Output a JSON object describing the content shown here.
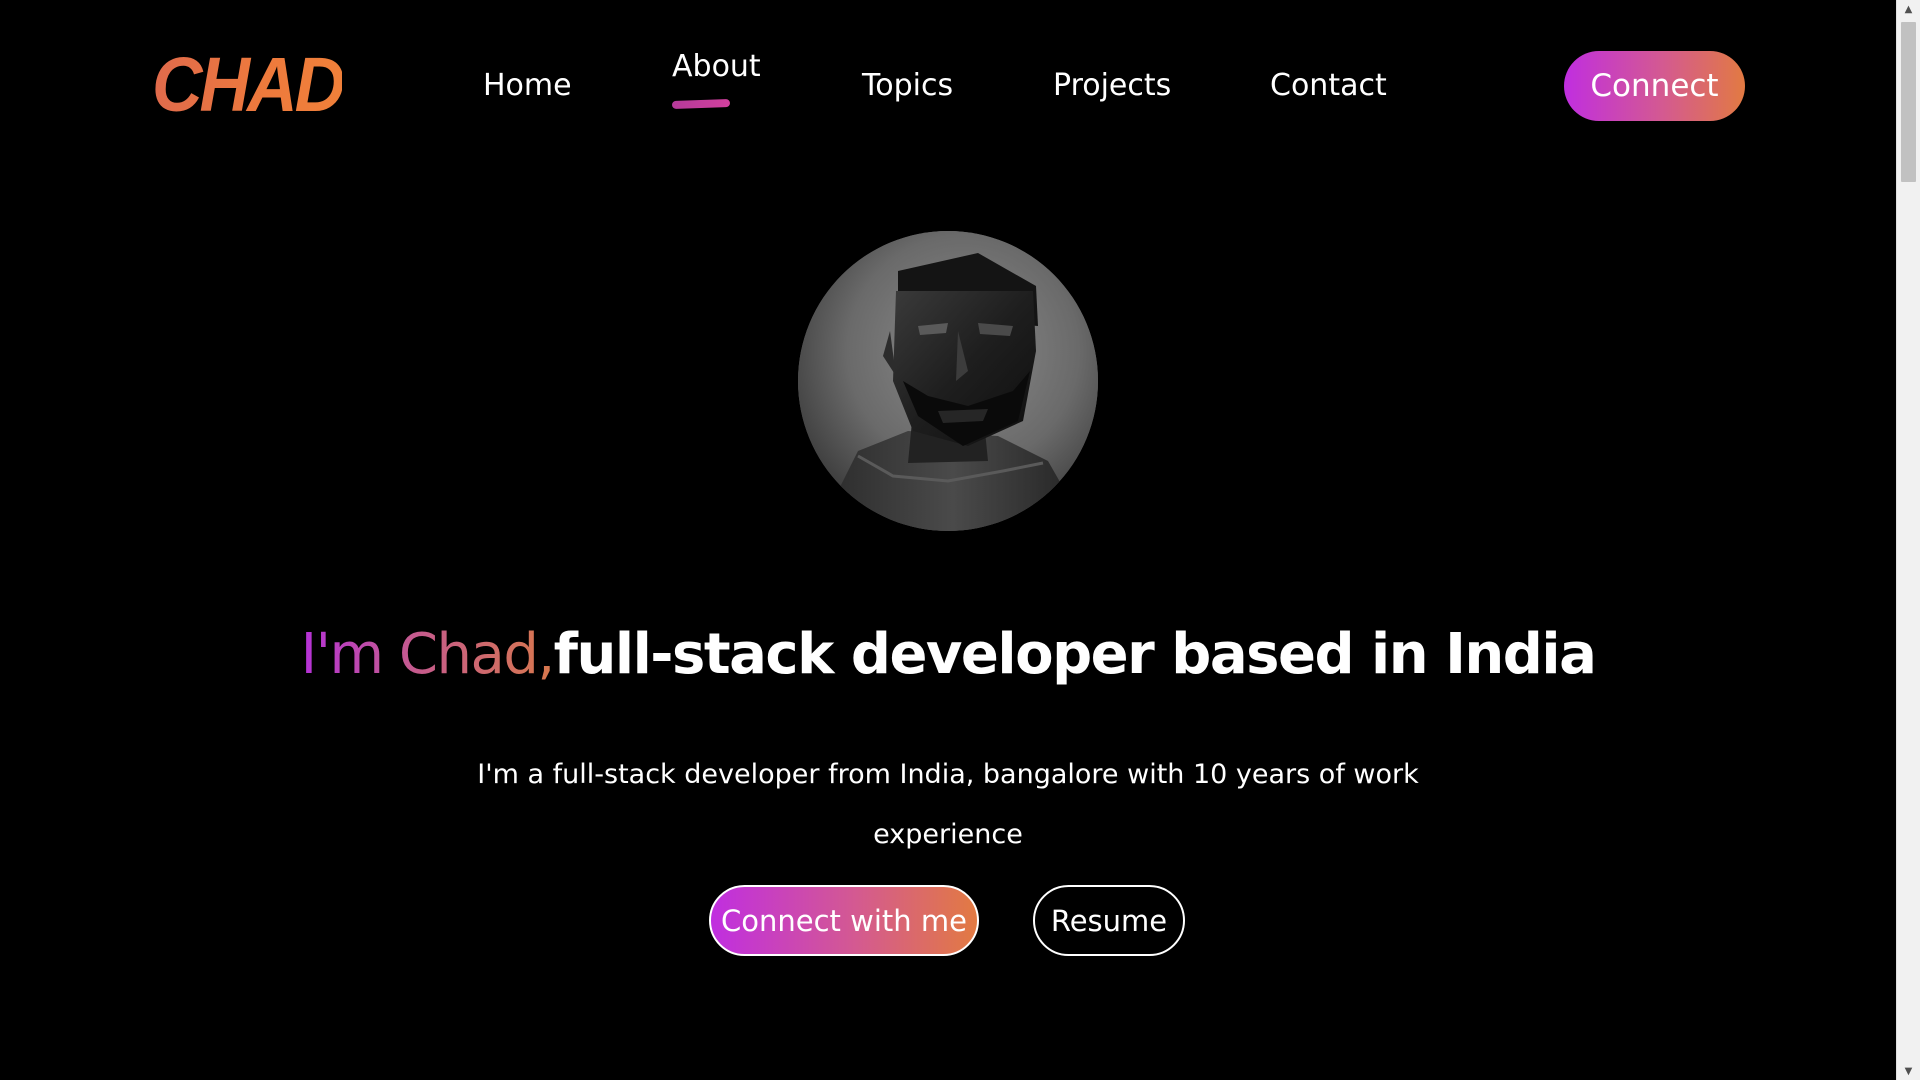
{
  "nav": {
    "logo": "CHAD",
    "links": [
      {
        "label": "Home"
      },
      {
        "label": "About",
        "active": true
      },
      {
        "label": "Topics"
      },
      {
        "label": "Projects"
      },
      {
        "label": "Contact"
      }
    ],
    "connect_label": "Connect"
  },
  "hero": {
    "greeting": "I'm Chad,",
    "headline_rest": "full-stack developer based in India",
    "description": "I'm a full-stack developer from India, bangalore with 10 years of work experience",
    "primary_button": "Connect with me",
    "secondary_button": "Resume"
  },
  "scrollbar": {
    "up_icon": "chevron-up-icon",
    "down_icon": "chevron-down-icon"
  },
  "colors": {
    "background": "#000000",
    "text": "#ffffff",
    "gradient_start": "#c02ee0",
    "gradient_mid": "#d45a90",
    "gradient_end": "#e27a42",
    "logo": "#ee7a3c"
  }
}
